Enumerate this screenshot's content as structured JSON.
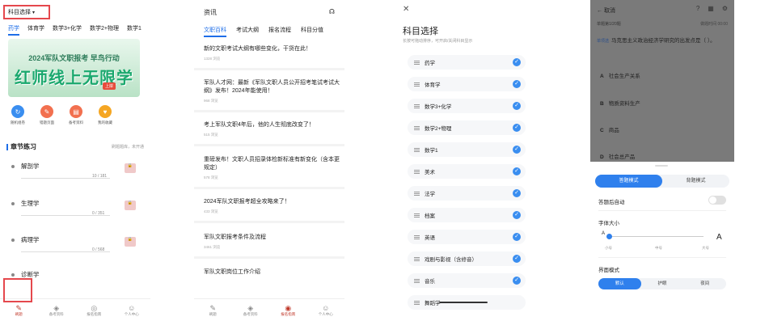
{
  "screen1": {
    "subject_select": "科目选择",
    "tabs": [
      "药学",
      "体育学",
      "数学3+化学",
      "数学2+物理",
      "数学1"
    ],
    "banner": {
      "line1": "",
      "line2": "2024军队文职报考 早鸟行动",
      "main": "红师线上无限学",
      "stamp": "上岸"
    },
    "quick": [
      {
        "label": "随机组卷",
        "icon": "shuffle-icon",
        "color": "#3a8ef0"
      },
      {
        "label": "错题页面",
        "icon": "wrong-questions-icon",
        "color": "#f2704f"
      },
      {
        "label": "备考资料",
        "icon": "materials-icon",
        "color": "#f2704f"
      },
      {
        "label": "我的收藏",
        "icon": "favorite-icon",
        "color": "#f5a623"
      }
    ],
    "section_title": "章节练习",
    "section_hint": "刷题题库，未开通",
    "chapters": [
      {
        "name": "解剖学",
        "count": "10 / 181"
      },
      {
        "name": "生理学",
        "count": "0 / 351"
      },
      {
        "name": "病理学",
        "count": "0 / 568"
      },
      {
        "name": "诊断学",
        "count": ""
      }
    ],
    "tabbar": [
      "刷题",
      "备考资料",
      "报名指南",
      "个人中心"
    ]
  },
  "screen2": {
    "title": "资讯",
    "tabs": [
      "文职百科",
      "考试大纲",
      "报名流程",
      "科目分值"
    ],
    "news": [
      {
        "title": "新的文职考试大纲有哪些变化，干货在此！",
        "meta": "1328 浏览"
      },
      {
        "title": "军队人才网：最新《军队文职人员公开招考笔试考试大纲》发布！2024年能使用！",
        "meta": "968 浏览"
      },
      {
        "title": "考上军队文职4年后，他的人生彻底改变了！",
        "meta": "515 浏览"
      },
      {
        "title": "重磅发布！文职人员招录体检新标准有新变化（含本更规定）",
        "meta": "578 浏览"
      },
      {
        "title": "2024军队文职报考超全攻略来了！",
        "meta": "433 浏览"
      },
      {
        "title": "军队文职报考条件及流程",
        "meta": "3461 浏览"
      },
      {
        "title": "军队文职岗位工作介绍",
        "meta": ""
      }
    ]
  },
  "screen3": {
    "close": "✕",
    "title": "科目选择",
    "subtitle": "长按可拖动排序，可开启/关闭科目显示",
    "subjects": [
      "药学",
      "体育学",
      "数学3+化学",
      "数学2+物理",
      "数学1",
      "美术",
      "法学",
      "档案",
      "英语",
      "戏剧与影视（含修音）",
      "音乐",
      "舞蹈学"
    ]
  },
  "screen4": {
    "nav_back": "← 取消",
    "nav_icons": [
      "help-icon",
      "grid-icon",
      "settings-icon"
    ],
    "progress": "单题第1/20题",
    "progress_right": "做题时间 00:00",
    "question_tag": "单项选",
    "question": "马克思主义政治经济学研究的出发点是（ ）。",
    "options": [
      {
        "key": "A",
        "text": "社会生产关系"
      },
      {
        "key": "B",
        "text": "物质资料生产"
      },
      {
        "key": "C",
        "text": "商品"
      },
      {
        "key": "D",
        "text": "社会总产品"
      }
    ],
    "modes": [
      "答题模式",
      "背题模式"
    ],
    "auto_next": "答题后自动",
    "font_size_label": "字体大小",
    "font_small": "A",
    "font_big": "A",
    "font_levels": [
      "小号",
      "中号",
      "大号"
    ],
    "theme_label": "界面模式",
    "themes": [
      "默认",
      "护眼",
      "夜间"
    ]
  }
}
